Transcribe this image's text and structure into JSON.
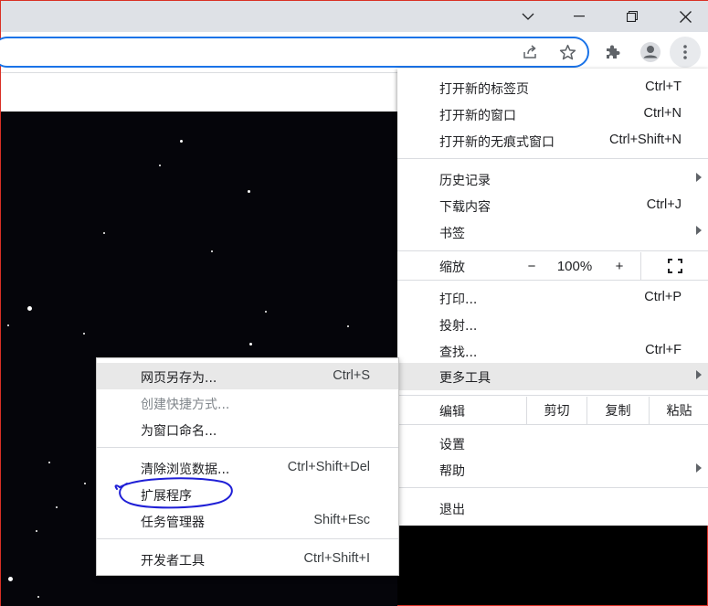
{
  "window": {
    "minimize_icon": "chevron-down",
    "maximize_icon": "restore",
    "close_icon": "close"
  },
  "toolbar": {
    "share_icon": "share",
    "bookmark_icon": "star",
    "extensions_icon": "puzzle",
    "profile_icon": "person",
    "menu_icon": "kebab"
  },
  "main_menu": {
    "new_tab": "打开新的标签页",
    "new_tab_sc": "Ctrl+T",
    "new_window": "打开新的窗口",
    "new_window_sc": "Ctrl+N",
    "incognito": "打开新的无痕式窗口",
    "incognito_sc": "Ctrl+Shift+N",
    "history": "历史记录",
    "downloads": "下载内容",
    "downloads_sc": "Ctrl+J",
    "bookmarks": "书签",
    "zoom": "缩放",
    "zoom_minus": "−",
    "zoom_level": "100%",
    "zoom_plus": "+",
    "print": "打印...",
    "print_sc": "Ctrl+P",
    "cast": "投射...",
    "find": "查找...",
    "find_sc": "Ctrl+F",
    "more_tools": "更多工具",
    "edit": "编辑",
    "cut": "剪切",
    "copy": "复制",
    "paste": "粘贴",
    "settings": "设置",
    "help": "帮助",
    "exit": "退出"
  },
  "sub_menu": {
    "save_page": "网页另存为...",
    "save_page_sc": "Ctrl+S",
    "create_shortcut": "创建快捷方式...",
    "name_window": "为窗口命名...",
    "clear_data": "清除浏览数据...",
    "clear_data_sc": "Ctrl+Shift+Del",
    "extensions": "扩展程序",
    "task_manager": "任务管理器",
    "task_manager_sc": "Shift+Esc",
    "dev_tools": "开发者工具",
    "dev_tools_sc": "Ctrl+Shift+I"
  },
  "colors": {
    "accent": "#1a73e8",
    "annotation": "#1f1fd6",
    "highlight": "#e8e8e8"
  }
}
